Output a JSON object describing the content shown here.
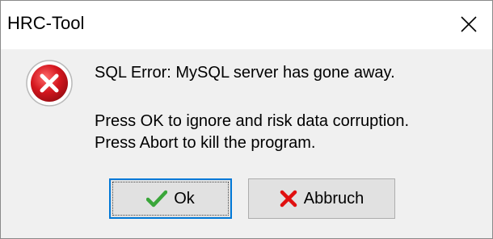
{
  "window": {
    "title": "HRC-Tool",
    "close_icon": "close-icon"
  },
  "message": {
    "icon": "error-icon",
    "line1": "SQL Error: MySQL server has gone away.",
    "line2": "Press OK to ignore and risk data corruption.",
    "line3": "Press Abort to kill the program."
  },
  "buttons": {
    "ok_label": "Ok",
    "ok_icon": "checkmark-icon",
    "abort_label": "Abbruch",
    "abort_icon": "red-x-icon"
  },
  "colors": {
    "focus_border": "#0078d7",
    "error_red": "#c8102e",
    "check_green": "#3aa63a",
    "cancel_red": "#e01010"
  }
}
